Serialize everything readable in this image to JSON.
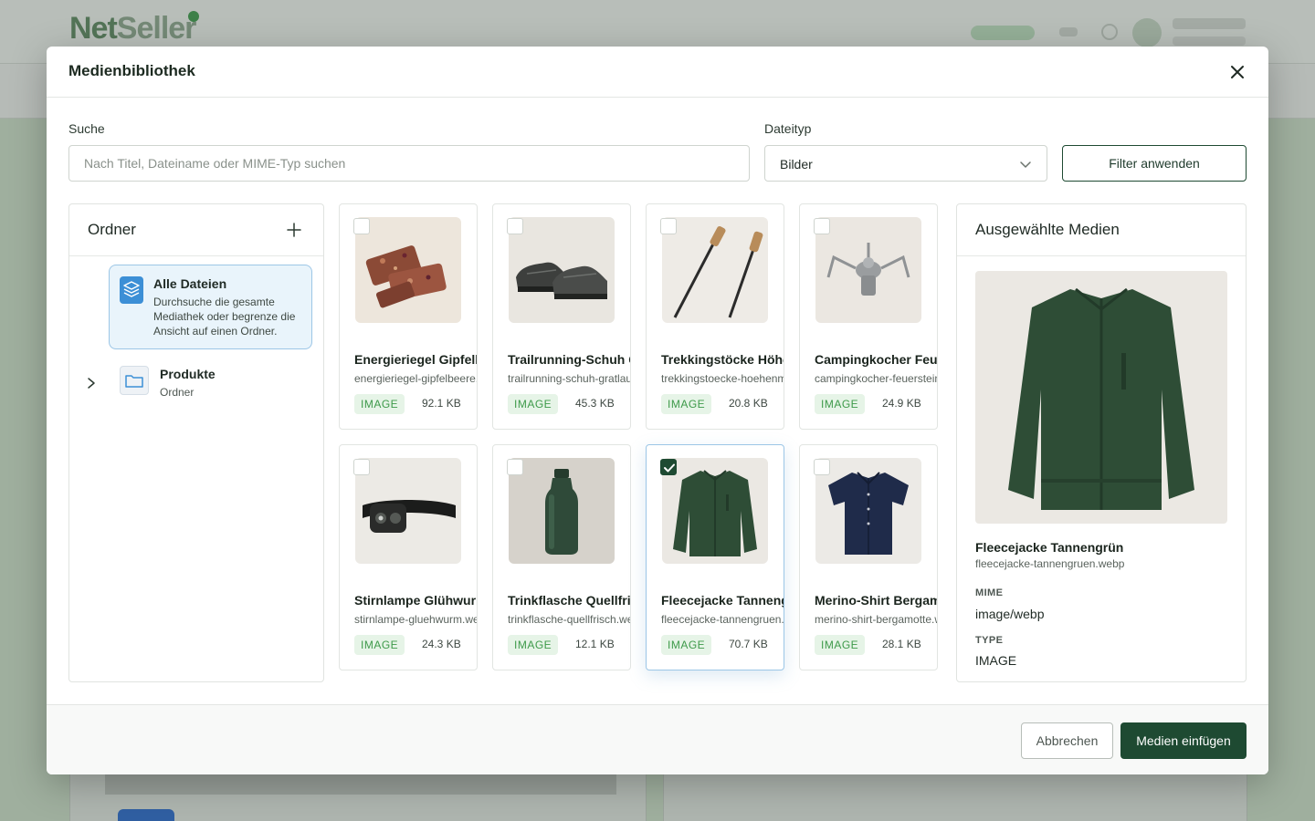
{
  "background": {
    "logo_primary": "Net",
    "logo_secondary": "Seller"
  },
  "modal": {
    "title": "Medienbibliothek",
    "search": {
      "label": "Suche",
      "placeholder": "Nach Titel, Dateiname oder MIME-Typ suchen",
      "value": ""
    },
    "filetype": {
      "label": "Dateityp",
      "selected": "Bilder"
    },
    "filter_button": "Filter anwenden",
    "folders": {
      "title": "Ordner",
      "all_files": {
        "title": "Alle Dateien",
        "description": "Durchsuche die gesamte Mediathek oder begrenze die Ansicht auf einen Ordner."
      },
      "items": [
        {
          "name": "Produkte",
          "subtitle": "Ordner"
        }
      ]
    },
    "media": [
      {
        "title": "Energieriegel Gipfelbeere",
        "file": "energieriegel-gipfelbeere.webp",
        "type": "IMAGE",
        "size": "92.1 KB",
        "checked": false,
        "thumb": "bar"
      },
      {
        "title": "Trailrunning-Schuh Gratlauf",
        "file": "trailrunning-schuh-gratlauf.webp",
        "type": "IMAGE",
        "size": "45.3 KB",
        "checked": false,
        "thumb": "shoe"
      },
      {
        "title": "Trekkingstöcke Höhenmeter",
        "file": "trekkingstoecke-hoehenmeter.webp",
        "type": "IMAGE",
        "size": "20.8 KB",
        "checked": false,
        "thumb": "poles"
      },
      {
        "title": "Campingkocher Feuerstein",
        "file": "campingkocher-feuerstein.webp",
        "type": "IMAGE",
        "size": "24.9 KB",
        "checked": false,
        "thumb": "stove"
      },
      {
        "title": "Stirnlampe Glühwurm",
        "file": "stirnlampe-gluehwurm.webp",
        "type": "IMAGE",
        "size": "24.3 KB",
        "checked": false,
        "thumb": "lamp"
      },
      {
        "title": "Trinkflasche Quellfrisch",
        "file": "trinkflasche-quellfrisch.webp",
        "type": "IMAGE",
        "size": "12.1 KB",
        "checked": false,
        "thumb": "bottle"
      },
      {
        "title": "Fleecejacke Tannengrün",
        "file": "fleecejacke-tannengruen.webp",
        "type": "IMAGE",
        "size": "70.7 KB",
        "checked": true,
        "thumb": "jacket"
      },
      {
        "title": "Merino-Shirt Bergamotte",
        "file": "merino-shirt-bergamotte.webp",
        "type": "IMAGE",
        "size": "28.1 KB",
        "checked": false,
        "thumb": "shirt"
      }
    ],
    "selected_panel": {
      "title": "Ausgewählte Medien",
      "name": "Fleecejacke Tannengrün",
      "file": "fleecejacke-tannengruen.webp",
      "mime_label": "MIME",
      "mime_value": "image/webp",
      "type_label": "TYPE",
      "type_value": "IMAGE"
    },
    "footer": {
      "cancel": "Abbrechen",
      "insert": "Medien einfügen"
    }
  },
  "colors": {
    "primary": "#1e4a32",
    "badge_bg": "#e6f4e7",
    "badge_text": "#3e9a4a",
    "highlight": "#9cc6e6"
  }
}
